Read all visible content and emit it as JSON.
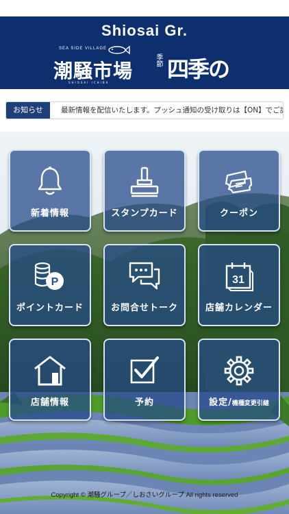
{
  "header": {
    "brand_title": "Shiosai Gr.",
    "logo_left": {
      "tagline": "SEA SIDE VILLAGE",
      "name": "潮騒市場",
      "sub": "SHIOSAI ICHIBA"
    },
    "logo_right": {
      "small": "季節",
      "name": "四季の蔵"
    },
    "background_color": "#0e2f6e"
  },
  "notice": {
    "label": "お知らせ",
    "text": "最新情報を配信いたします。プッシュ通知の受け取りは【ON】でご設定ください。"
  },
  "menu": [
    {
      "label": "新着情報",
      "icon": "bell-icon"
    },
    {
      "label": "スタンプカード",
      "icon": "stamp-icon"
    },
    {
      "label": "クーポン",
      "icon": "coupon-icon"
    },
    {
      "label": "ポイントカード",
      "icon": "point-coins-icon"
    },
    {
      "label": "お問合せトーク",
      "icon": "chat-icon"
    },
    {
      "label": "店舗カレンダー",
      "icon": "calendar-icon"
    },
    {
      "label": "店舗情報",
      "icon": "store-icon"
    },
    {
      "label": "予約",
      "icon": "checkbox-icon"
    },
    {
      "label": "設定/",
      "label_small": "機種変更引継",
      "icon": "gear-icon"
    }
  ],
  "calendar_day": "31",
  "point_symbol": "P",
  "footer": {
    "copyright": "Copyright © 潮騒グループ／しおさいグループ All rights reserved"
  }
}
